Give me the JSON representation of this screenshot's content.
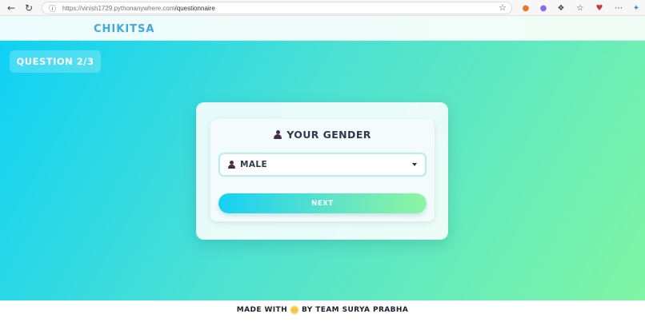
{
  "browser": {
    "url_host": "https://vinish1729.pythonanywhere.com",
    "url_path": "/questionnaire"
  },
  "site": {
    "logo_text": "CHIKITSA"
  },
  "question": {
    "progress_label": "QUESTION 2/3",
    "progress_current": 2,
    "progress_total": 3,
    "title": "YOUR GENDER",
    "select_value": "MALE",
    "next_label": "NEXT"
  },
  "footer": {
    "prefix": "MADE WITH",
    "suffix": "BY TEAM SURYA PRABHA"
  },
  "colors": {
    "gradient_start": "#0fd1f5",
    "gradient_end": "#80f5a4",
    "text_dark": "#2f3a4a"
  }
}
